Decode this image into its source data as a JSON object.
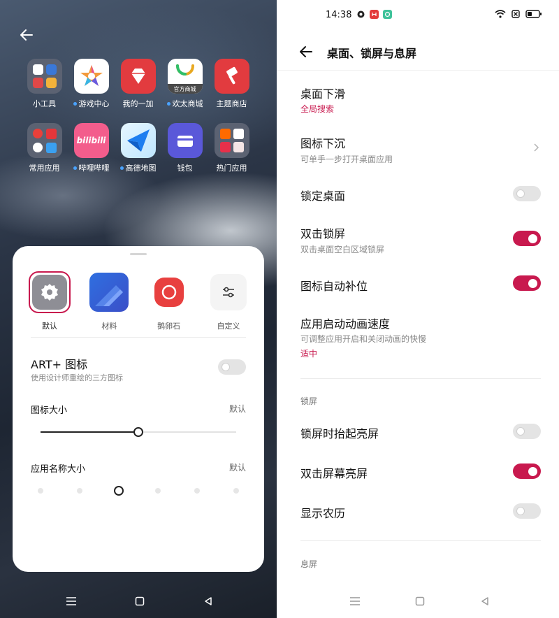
{
  "launcher": {
    "rows": [
      [
        {
          "label": "小工具",
          "dot": false
        },
        {
          "label": "游戏中心",
          "dot": true
        },
        {
          "label": "我的一加",
          "dot": false
        },
        {
          "label": "欢太商城",
          "dot": true,
          "badge": "官方商城"
        },
        {
          "label": "主题商店",
          "dot": false
        }
      ],
      [
        {
          "label": "常用应用",
          "dot": false
        },
        {
          "label": "哔哩哔哩",
          "dot": true,
          "badge": "bilibili"
        },
        {
          "label": "高德地图",
          "dot": true
        },
        {
          "label": "钱包",
          "dot": false
        },
        {
          "label": "热门应用",
          "dot": false
        }
      ]
    ]
  },
  "sheet": {
    "styles": [
      {
        "label": "默认",
        "selected": true
      },
      {
        "label": "材料",
        "selected": false
      },
      {
        "label": "鹅卵石",
        "selected": false
      },
      {
        "label": "自定义",
        "selected": false
      }
    ],
    "art": {
      "title": "ART+ 图标",
      "subtitle": "使用设计师重绘的三方图标",
      "enabled": false
    },
    "icon_size": {
      "label": "图标大小",
      "value": "默认",
      "level": 0.5
    },
    "name_size": {
      "label": "应用名称大小",
      "value": "默认",
      "position": 2,
      "steps": 6
    }
  },
  "status_bar": {
    "time": "14:38"
  },
  "header": {
    "title": "桌面、锁屏与息屏"
  },
  "settings": {
    "swipe_down": {
      "title": "桌面下滑",
      "value": "全局搜索"
    },
    "icon_sink": {
      "title": "图标下沉",
      "subtitle": "可单手一步打开桌面应用"
    },
    "lock_desktop": {
      "title": "锁定桌面",
      "enabled": false
    },
    "double_tap_lock": {
      "title": "双击锁屏",
      "subtitle": "双击桌面空白区域锁屏",
      "enabled": true
    },
    "auto_fill": {
      "title": "图标自动补位",
      "enabled": true
    },
    "anim_speed": {
      "title": "应用启动动画速度",
      "subtitle": "可调整应用开启和关闭动画的快慢",
      "value": "适中"
    },
    "lock_section": "锁屏",
    "raise_to_wake": {
      "title": "锁屏时抬起亮屏",
      "enabled": false
    },
    "double_tap_wake": {
      "title": "双击屏幕亮屏",
      "enabled": true
    },
    "lunar": {
      "title": "显示农历",
      "enabled": false
    },
    "aod_section": "息屏"
  },
  "colors": {
    "accent": "#c8194e"
  }
}
